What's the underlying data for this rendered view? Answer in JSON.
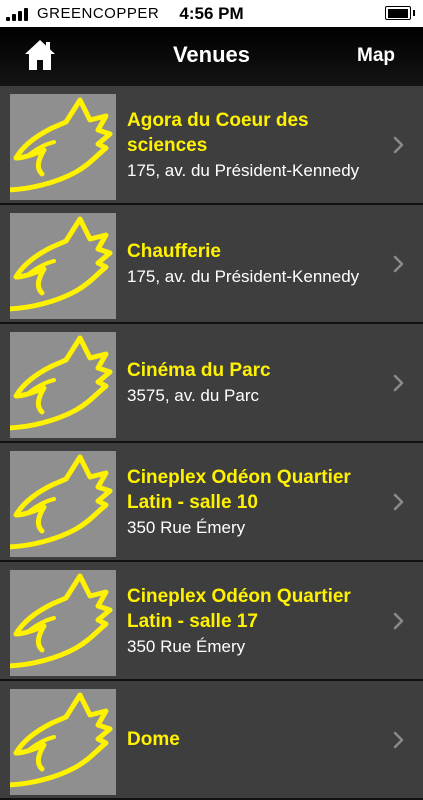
{
  "status": {
    "carrier": "GREENCOPPER",
    "time": "4:56 PM"
  },
  "nav": {
    "title": "Venues",
    "map_label": "Map",
    "home_icon": "home-icon"
  },
  "colors": {
    "venue_name": "#fff200",
    "row_bg": "#3e3e3e",
    "thumb_bg": "#8f8f8f"
  },
  "venues": [
    {
      "name": "Agora du Coeur des sciences",
      "address": "175, av. du Président-Kennedy"
    },
    {
      "name": "Chaufferie",
      "address": "175, av. du Président-Kennedy"
    },
    {
      "name": "Cinéma du Parc",
      "address": "3575, av. du Parc"
    },
    {
      "name": "Cineplex Odéon Quartier Latin - salle 10",
      "address": "350 Rue Émery"
    },
    {
      "name": "Cineplex Odéon Quartier Latin - salle 17",
      "address": "350 Rue Émery"
    },
    {
      "name": "Dome",
      "address": ""
    }
  ]
}
